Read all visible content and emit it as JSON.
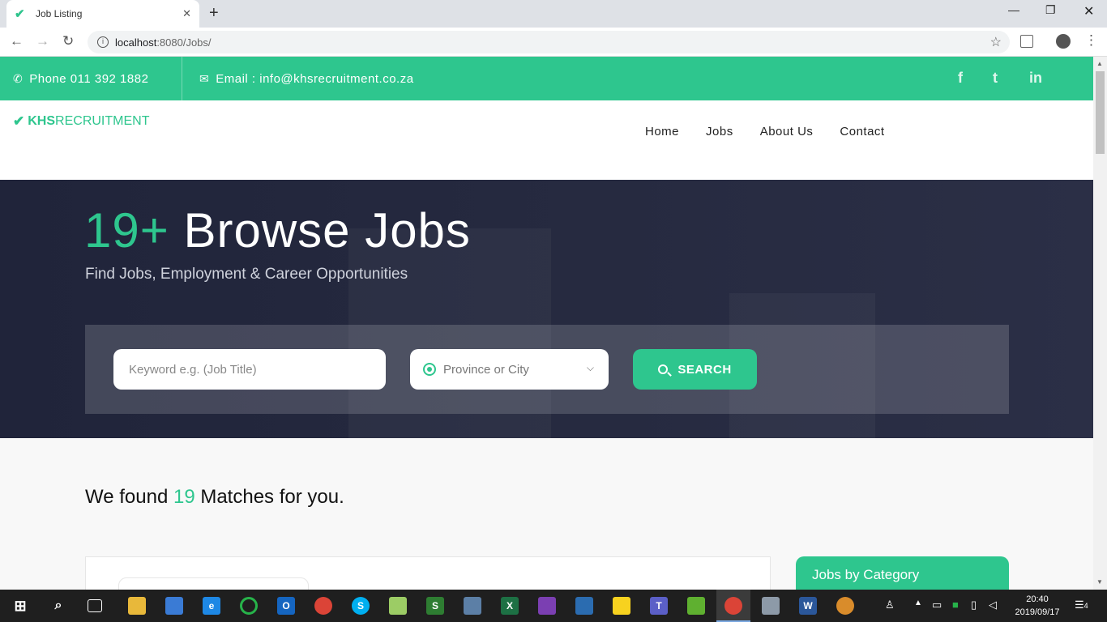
{
  "browser": {
    "tab_title": "Job Listing",
    "url_host": "localhost",
    "url_path": ":8080/Jobs/"
  },
  "topbar": {
    "phone_label": "Phone",
    "phone_number": "011 392 1882",
    "email_label": "Email :",
    "email_value": "info@khsrecruitment.co.za",
    "social": [
      "f",
      "t",
      "in"
    ]
  },
  "logo": {
    "bold": "KHS",
    "rest": "RECRUITMENT"
  },
  "nav": [
    "Home",
    "Jobs",
    "About Us",
    "Contact"
  ],
  "hero": {
    "count": "19+",
    "title": "Browse Jobs",
    "subtitle": "Find Jobs, Employment & Career Opportunities"
  },
  "search": {
    "keyword_placeholder": "Keyword e.g. (Job Title)",
    "location_placeholder": "Province or City",
    "button_label": "SEARCH"
  },
  "results": {
    "prefix": "We found",
    "count": "19",
    "suffix": "Matches for you."
  },
  "sidebar": {
    "category_title": "Jobs by Category"
  },
  "taskbar": {
    "time": "20:40",
    "date": "2019/09/17",
    "notifications": "4"
  },
  "colors": {
    "accent": "#2ec68e",
    "hero_bg": "#23273d"
  }
}
